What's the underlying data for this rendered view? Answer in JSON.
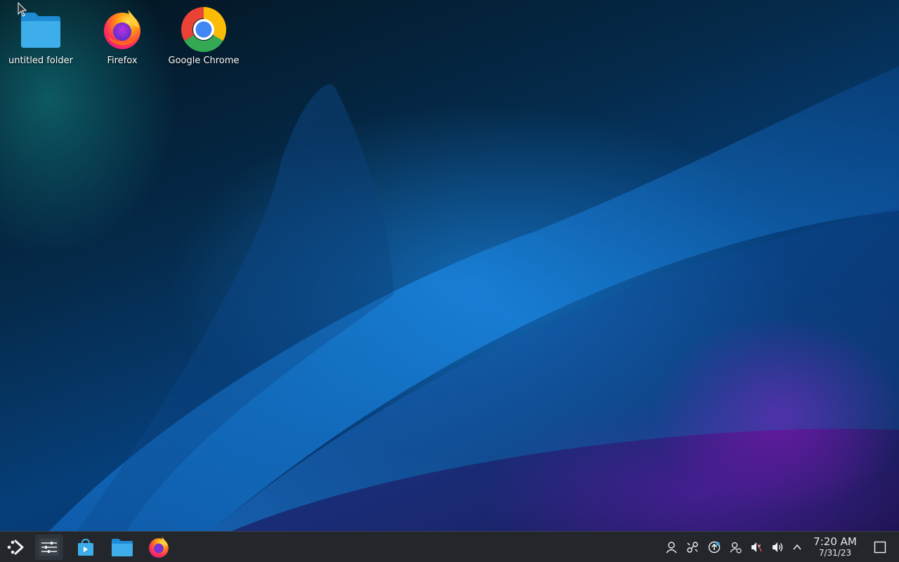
{
  "desktop": {
    "icons": [
      {
        "label": "untitled folder",
        "icon": "folder-icon"
      },
      {
        "label": "Firefox",
        "icon": "firefox-icon"
      },
      {
        "label": "Google Chrome",
        "icon": "chrome-icon"
      }
    ]
  },
  "taskbar": {
    "launchers": [
      {
        "icon": "application-launcher-icon"
      },
      {
        "icon": "system-settings-icon"
      },
      {
        "icon": "discover-store-icon"
      },
      {
        "icon": "file-manager-icon"
      },
      {
        "icon": "firefox-icon"
      }
    ],
    "tray": [
      {
        "icon": "user-icon"
      },
      {
        "icon": "kdeconnect-icon"
      },
      {
        "icon": "updates-icon"
      },
      {
        "icon": "user-switch-icon"
      },
      {
        "icon": "speaker-muted-icon"
      },
      {
        "icon": "volume-icon"
      },
      {
        "icon": "chevron-up-icon"
      }
    ],
    "clock": {
      "time": "7:20 AM",
      "date": "7/31/23"
    },
    "show_desktop_icon": "show-desktop-icon"
  },
  "colors": {
    "taskbar_bg": "#23272c",
    "accent": "#3daee9"
  }
}
